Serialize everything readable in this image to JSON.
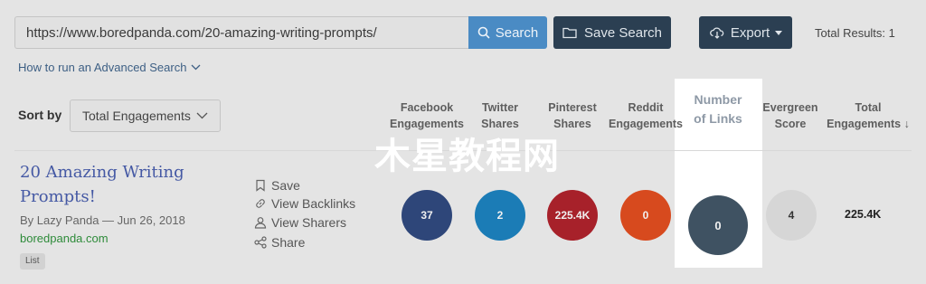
{
  "search": {
    "url_value": "https://www.boredpanda.com/20-amazing-writing-prompts/",
    "search_label": "Search",
    "save_search_label": "Save Search",
    "export_label": "Export",
    "total_results": "Total Results: 1",
    "advanced_link": "How to run an Advanced Search"
  },
  "sort": {
    "label": "Sort by",
    "selected": "Total Engagements"
  },
  "columns": {
    "facebook": [
      "Facebook",
      "Engagements"
    ],
    "twitter": [
      "Twitter",
      "Shares"
    ],
    "pinterest": [
      "Pinterest",
      "Shares"
    ],
    "reddit": [
      "Reddit",
      "Engagements"
    ],
    "links": [
      "Number",
      "of Links"
    ],
    "evergreen": [
      "Evergreen",
      "Score"
    ],
    "total": [
      "Total",
      "Engagements ↓"
    ]
  },
  "result": {
    "title": "20 Amazing Writing Prompts!",
    "byline": "By Lazy Panda — Jun 26, 2018",
    "domain": "boredpanda.com",
    "tag": "List",
    "actions": {
      "save": "Save",
      "backlinks": "View Backlinks",
      "sharers": "View Sharers",
      "share": "Share"
    },
    "metrics": {
      "facebook": "37",
      "twitter": "2",
      "pinterest": "225.4K",
      "reddit": "0",
      "links": "0",
      "evergreen": "4",
      "total": "225.4K"
    }
  },
  "colors": {
    "facebook": "#2e4679",
    "twitter": "#1b7cb6",
    "pinterest": "#a7212a",
    "reddit": "#d74a1e",
    "links": "#3f5262",
    "evergreen": "#d6d6d6",
    "primary_button": "#4a8bc4",
    "dark_button": "#2b3f52"
  },
  "watermark": "木星教程网"
}
